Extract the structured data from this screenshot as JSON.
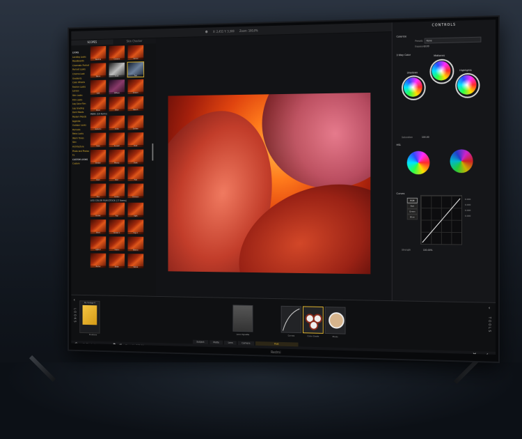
{
  "topbar": {
    "coords": "X: 2,451  Y: 3,300",
    "zoom": "Zoom: 100,0%"
  },
  "left_panel": {
    "tabs": [
      "SCOPES",
      "Skin Checker"
    ],
    "categories": [
      "LOOKS",
      "Landing Looks",
      "Moodboards",
      "Cinematic Portraits",
      "Portrait Looks",
      "Cinema Look",
      "Gradients",
      "Color Wheels",
      "Fashion Looks",
      "Lenses",
      "Skin Looks",
      "Film Looks",
      "Log Color Film",
      "Log Grading",
      "Dark Moods",
      "Modern Moods",
      "Nightlife",
      "Outdoor Looks",
      "Portraits",
      "Retro Looks",
      "Warm Tones",
      "Skin",
      "Architecture",
      "Photo and Photos",
      "Fx",
      "CUSTOM LOOKS",
      "Custom"
    ],
    "sections": [
      {
        "title": "",
        "thumbs": [
          "Neutral",
          "Cinema",
          "Camel",
          "Warm",
          "Dust",
          "Teal",
          "Soft",
          "Diffuse",
          "Dream",
          "Silver",
          "Blue",
          "Beach"
        ]
      },
      {
        "title": "INDIE (16 items)",
        "thumbs": [
          "Autumn",
          "Indie",
          "Golden",
          "Fade",
          "Sunset",
          "Rust",
          "Ember",
          "Moody",
          "Dusk",
          "Dark",
          "Noir",
          "Flat",
          "Film",
          "Amber",
          "Crimson"
        ]
      },
      {
        "title": "LOG COLOR FILM STOCK (17 items)",
        "thumbs": [
          "Kodak",
          "Fuji",
          "Agfa",
          "Ilford",
          "Kodak 2",
          "Fuji 2",
          "Agfa 2",
          "Vision",
          "Eterna",
          "Portra",
          "Ektar",
          "Velvia"
        ]
      }
    ]
  },
  "controls": {
    "title": "CONTROLS",
    "colorize_label": "Colorize",
    "preset_label": "Presets",
    "preset_value": "None",
    "exposure_label": "Exposure",
    "exposure_value": "0.00",
    "way_label": "3 Way Color",
    "wheels": [
      "Shadows",
      "Midtones",
      "Highlights"
    ],
    "saturation_label": "Saturation",
    "saturation_value": "100.00",
    "hsl_label": "HSL",
    "curves_label": "Curves",
    "channels": [
      "RGB",
      "Red",
      "Green",
      "Blue"
    ],
    "curve_values": [
      "0.000",
      "0.000",
      "0.000",
      "0.000"
    ],
    "strength_label": "Strength",
    "strength_value": "100.00%"
  },
  "bottom": {
    "looks_label": "LOOKS",
    "tools_label": "TOOLS",
    "look_name": "My Vintage 4",
    "look_sub": "Duotone",
    "tools": [
      "Lens Vignette",
      "Curves",
      "Color Grade",
      "Photo"
    ],
    "tabs": [
      "Subject",
      "Matte",
      "Lens",
      "Camera",
      "Post"
    ],
    "status_left": "with Shortcuts",
    "status_right": "Strength: 100,0%"
  },
  "tv_logo": "Redmi"
}
